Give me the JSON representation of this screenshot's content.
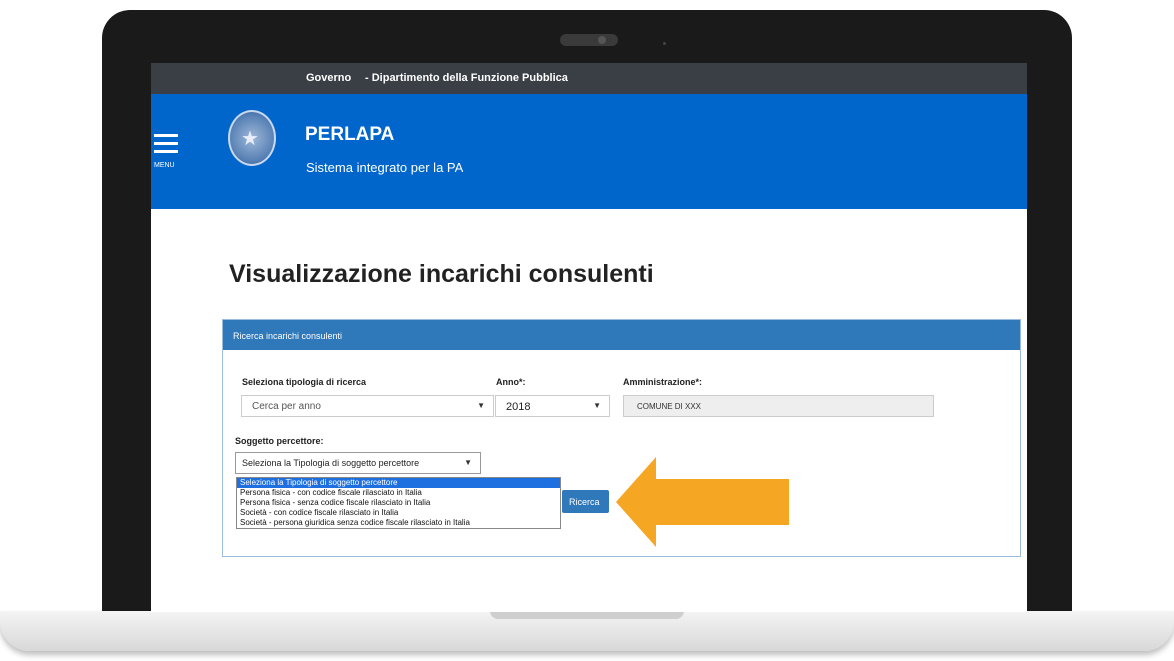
{
  "topbar": {
    "gov": "Governo",
    "dept": "- Dipartimento della Funzione Pubblica"
  },
  "header": {
    "menu_label": "MENU",
    "title": "PERLAPA",
    "subtitle": "Sistema integrato per la PA"
  },
  "page": {
    "title": "Visualizzazione incarichi consulenti"
  },
  "panel": {
    "heading": "Ricerca incarichi consulenti",
    "tipologia_label": "Seleziona tipologia di ricerca",
    "tipologia_value": "Cerca per anno",
    "anno_label": "Anno*:",
    "anno_value": "2018",
    "amministrazione_label": "Amministrazione*:",
    "amministrazione_value": "COMUNE DI XXX",
    "soggetto_label": "Soggetto percettore:",
    "soggetto_value": "Seleziona la Tipologia di soggetto percettore",
    "options": [
      "Seleziona la Tipologia di soggetto percettore",
      "Persona fisica - con codice fiscale rilasciato in Italia",
      "Persona fisica - senza codice fiscale rilasciato in Italia",
      "Società - con codice fiscale rilasciato in Italia",
      "Società - persona giuridica senza codice fiscale rilasciato in Italia"
    ],
    "search_button": "Ricerca"
  },
  "colors": {
    "header_blue": "#0066cc",
    "panel_blue": "#2f78b9",
    "arrow_orange": "#f5a623",
    "topbar": "#3a3f45"
  },
  "icons": {
    "menu": "hamburger-icon",
    "emblem": "italian-republic-emblem",
    "caret": "caret-down-icon",
    "arrow": "arrow-left-icon"
  }
}
